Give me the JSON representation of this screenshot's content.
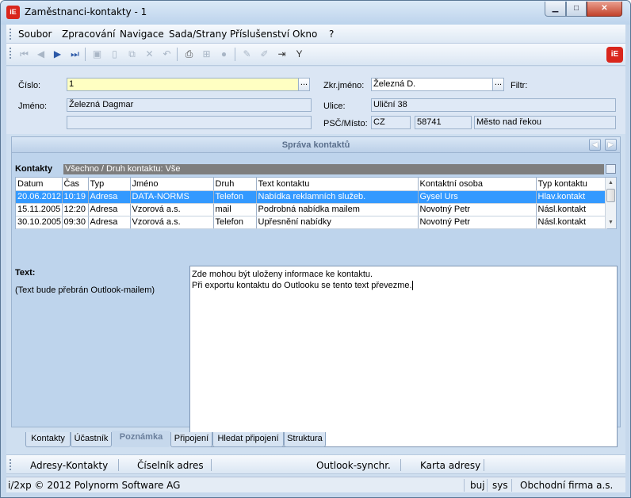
{
  "window": {
    "title": "Zaměstnanci-kontakty - 1",
    "icon_text": "iE",
    "min_glyph": "▁",
    "max_glyph": "□",
    "close_glyph": "✕"
  },
  "menu": [
    "Soubor",
    "Zpracování",
    "Navigace",
    "Sada/Strany",
    "Příslušenství",
    "Okno",
    "?"
  ],
  "toolbar": {
    "icons": [
      "first-record-icon",
      "prev-record-icon",
      "next-record-icon",
      "last-record-icon",
      "save-icon",
      "new-icon",
      "copy-icon",
      "delete-icon",
      "undo-icon",
      "print-icon",
      "tree-icon",
      "disabled-circle-icon",
      "edit-icon",
      "edit-light-icon",
      "export-icon",
      "filter-icon"
    ],
    "logo_text": "iE"
  },
  "form": {
    "cislo_label": "Číslo:",
    "cislo_value": "1",
    "jmeno_label": "Jméno:",
    "jmeno_value": "Železná Dagmar",
    "jmeno_value2": "",
    "zkr_label": "Zkr.jméno:",
    "zkr_value": "Železná D.",
    "filtr_label": "Filtr:",
    "ulice_label": "Ulice:",
    "ulice_value": "Uliční 38",
    "psc_label": "PSČ/Místo:",
    "country": "CZ",
    "psc": "58741",
    "mesto": "Město nad řekou",
    "dots": "..."
  },
  "panel": {
    "title": "Správa kontaktů",
    "kontakty_label": "Kontakty",
    "filter_text": "Všechno / Druh kontaktu: Vše",
    "columns": [
      "Datum",
      "Čas",
      "Typ",
      "Jméno",
      "Druh",
      "Text kontaktu",
      "Kontaktní osoba",
      "Typ kontaktu"
    ],
    "rows": [
      [
        "20.06.2012",
        "10:19",
        "Adresa",
        "DATA-NORMS",
        "Telefon",
        "Nabídka reklamních služeb.",
        "Gysel Urs",
        "Hlav.kontakt"
      ],
      [
        "15.11.2005",
        "12:20",
        "Adresa",
        "Vzorová a.s.",
        "mail",
        "Podrobná nabídka mailem",
        "Novotný Petr",
        "Násl.kontakt"
      ],
      [
        "30.10.2005",
        "09:30",
        "Adresa",
        "Vzorová a.s.",
        "Telefon",
        "Upřesnění nabídky",
        "Novotný Petr",
        "Násl.kontakt"
      ]
    ],
    "text_label": "Text:",
    "text_note": "(Text bude přebrán Outlook-mailem)",
    "memo_line1": "Zde mohou být uloženy informace ke kontaktu.",
    "memo_line2": "Při exportu kontaktu do Outlooku se tento text převezme."
  },
  "tabs": [
    "Kontakty",
    "Účastník",
    "Poznámka",
    "Připojení",
    "Hledat připojení",
    "Struktura"
  ],
  "active_tab": "Poznámka",
  "bottom_buttons": [
    "Adresy-Kontakty",
    "Číselník adres",
    "Outlook-synchr.",
    "Karta adresy"
  ],
  "status": {
    "copyright": "i/2xp © 2012 Polynorm Software AG",
    "mode": "buj",
    "user": "sys",
    "company": "Obchodní firma a.s."
  }
}
